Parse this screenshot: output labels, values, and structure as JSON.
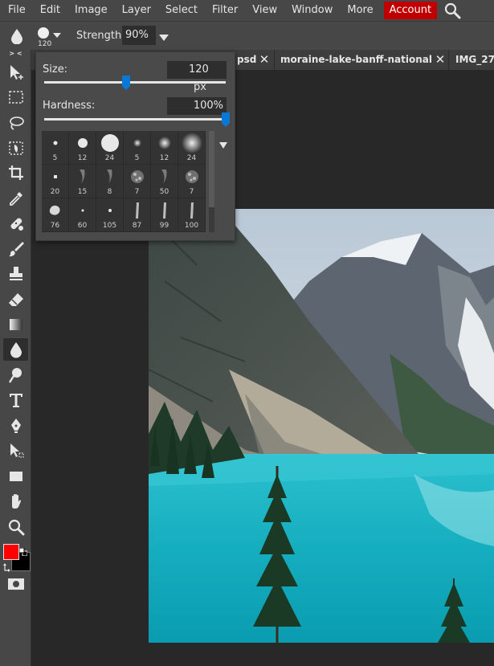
{
  "menubar": {
    "items": [
      "File",
      "Edit",
      "Image",
      "Layer",
      "Select",
      "Filter",
      "View",
      "Window",
      "More"
    ],
    "account_label": "Account",
    "search_icon": "search-icon"
  },
  "options": {
    "tool_icon": "blur-drop-icon",
    "brush_size_badge": "120",
    "strength_label": "Strength:",
    "strength_value": "90%"
  },
  "tabs": [
    {
      "label": "psd",
      "close": "✕"
    },
    {
      "label": "moraine-lake-banff-national",
      "close": "✕"
    },
    {
      "label": "IMG_27",
      "close": ""
    }
  ],
  "toolbar": {
    "collapse_label": "> <",
    "tools": [
      "move-icon",
      "marquee-icon",
      "lasso-icon",
      "quick-select-icon",
      "crop-icon",
      "eyedropper-icon",
      "healing-icon",
      "brush-icon",
      "stamp-icon",
      "eraser-icon",
      "gradient-icon",
      "blur-drop-icon",
      "dodge-icon",
      "type-icon",
      "pen-icon",
      "path-select-icon",
      "shape-icon",
      "hand-icon",
      "zoom-icon"
    ],
    "active_tool": "blur-drop-icon",
    "foreground_color": "#ff0000",
    "background_color": "#000000"
  },
  "brush_popup": {
    "size_label": "Size:",
    "size_value": "120",
    "size_unit": "px",
    "size_fraction": 0.45,
    "hardness_label": "Hardness:",
    "hardness_value": "100%",
    "hardness_fraction": 1.0,
    "presets": [
      {
        "label": "5"
      },
      {
        "label": "12"
      },
      {
        "label": "24"
      },
      {
        "label": "5"
      },
      {
        "label": "12"
      },
      {
        "label": "24"
      },
      {
        "label": "20"
      },
      {
        "label": "15"
      },
      {
        "label": "8"
      },
      {
        "label": "7"
      },
      {
        "label": "50"
      },
      {
        "label": "7"
      },
      {
        "label": "76"
      },
      {
        "label": "60"
      },
      {
        "label": "105"
      },
      {
        "label": "87"
      },
      {
        "label": "99"
      },
      {
        "label": "100"
      }
    ]
  },
  "colors": {
    "accent": "#0a78d7",
    "account": "#c00000",
    "panel": "#474747",
    "background": "#282828"
  }
}
